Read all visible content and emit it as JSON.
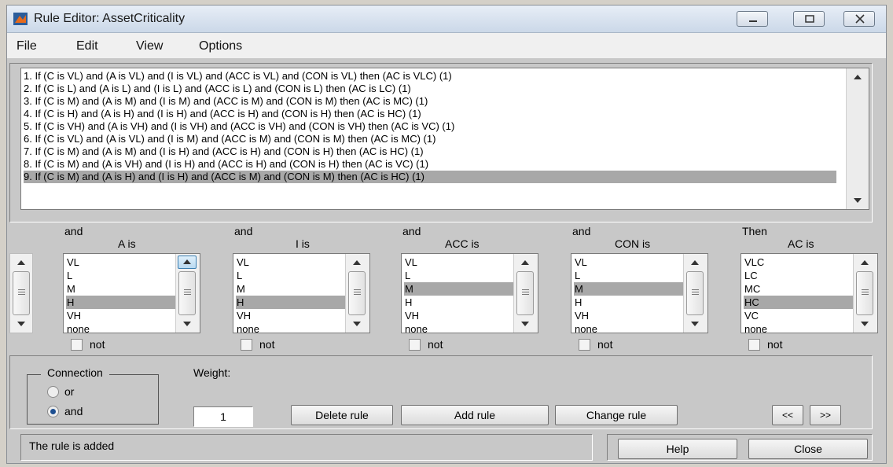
{
  "window": {
    "title": "Rule Editor: AssetCriticality"
  },
  "menu": [
    "File",
    "Edit",
    "View",
    "Options"
  ],
  "rules": [
    "1. If (C is VL) and (A is VL) and (I is VL) and (ACC is VL) and (CON is VL) then (AC is VLC) (1)",
    "2. If (C is L) and (A is L) and (I is L) and (ACC is L) and (CON is L) then (AC is LC) (1)",
    "3. If (C is M) and (A is M) and (I is M) and (ACC is M) and (CON is M) then (AC is MC) (1)",
    "4. If (C is H) and (A is H) and (I is H) and (ACC is H) and (CON is H) then (AC is HC) (1)",
    "5. If (C is VH) and (A is VH) and (I is VH) and (ACC is VH) and (CON is VH) then (AC is VC) (1)",
    "6. If (C is VL) and (A is VL) and (I is M) and (ACC is M) and (CON is M) then (AC is MC) (1)",
    "7. If (C is M) and (A is M) and (I is H) and (ACC is H) and (CON is H) then (AC is HC) (1)",
    "8. If (C is M) and (A is VH) and (I is H) and (ACC is H) and (CON is H) then (AC is VC) (1)",
    "9. If (C is M) and (A is H) and (I is H) and (ACC is M) and (CON is M) then (AC is HC) (1)"
  ],
  "selected_rule": 9,
  "variables": [
    {
      "conj": "and",
      "name": "A is",
      "options": [
        "VL",
        "L",
        "M",
        "H",
        "VH",
        "none"
      ],
      "selected": "H",
      "not_label": "not"
    },
    {
      "conj": "and",
      "name": "I is",
      "options": [
        "VL",
        "L",
        "M",
        "H",
        "VH",
        "none"
      ],
      "selected": "H",
      "not_label": "not"
    },
    {
      "conj": "and",
      "name": "ACC is",
      "options": [
        "VL",
        "L",
        "M",
        "H",
        "VH",
        "none"
      ],
      "selected": "M",
      "not_label": "not"
    },
    {
      "conj": "and",
      "name": "CON is",
      "options": [
        "VL",
        "L",
        "M",
        "H",
        "VH",
        "none"
      ],
      "selected": "M",
      "not_label": "not"
    },
    {
      "conj": "Then",
      "name": "AC is",
      "options": [
        "VLC",
        "LC",
        "MC",
        "HC",
        "VC",
        "none"
      ],
      "selected": "HC",
      "not_label": "not"
    }
  ],
  "connection": {
    "label": "Connection",
    "or_label": "or",
    "and_label": "and",
    "selected": "and"
  },
  "weight": {
    "label": "Weight:",
    "value": "1"
  },
  "buttons": {
    "delete": "Delete rule",
    "add": "Add rule",
    "change": "Change rule",
    "prev": "<<",
    "next": ">>",
    "help": "Help",
    "close": "Close"
  },
  "status": "The rule is added"
}
